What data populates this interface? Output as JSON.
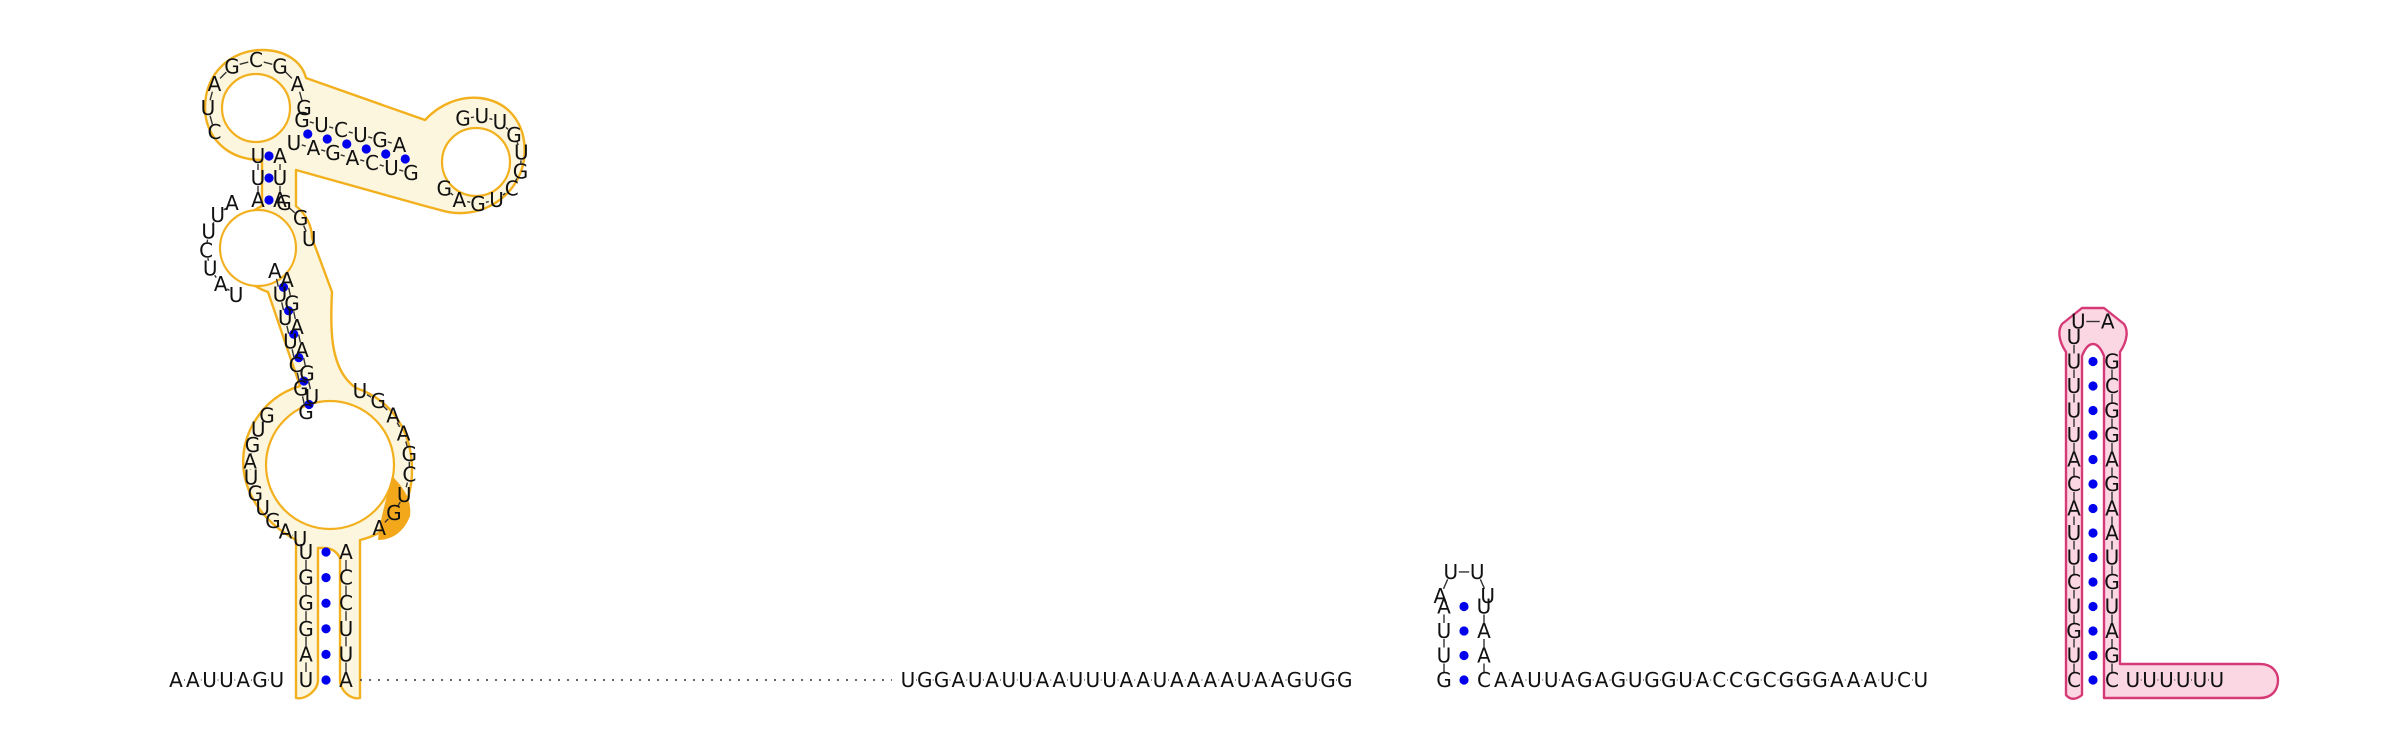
{
  "colors": {
    "outline_orange": "#f2b01e",
    "fill_orange": "#fdf6de",
    "highlight_orange": "#f2a81a",
    "outline_pink": "#d63a76",
    "fill_pink": "#fbd7e3",
    "pair_dot": "#0000ee",
    "text": "#111111"
  },
  "sequence_5prime": "AAUUAGU",
  "gap_note": "unpaired dotted region",
  "right_arm": "UGGAUAUUAAUUUAAUAAAAUAAGUGG",
  "small_hairpin": {
    "stem_5": "AUUG",
    "loop": "AUUU",
    "stem_3": "UAAC"
  },
  "tail": "AAUUAGAGUGGUACCGCGGGAAAUCU",
  "terminator_hairpin": {
    "stem_5": "CUGUCUUACAUUUUU",
    "loop": "UA",
    "stem_3": "CGAUGUAAGAGGCG"
  },
  "trailing": "UUUUUU"
}
